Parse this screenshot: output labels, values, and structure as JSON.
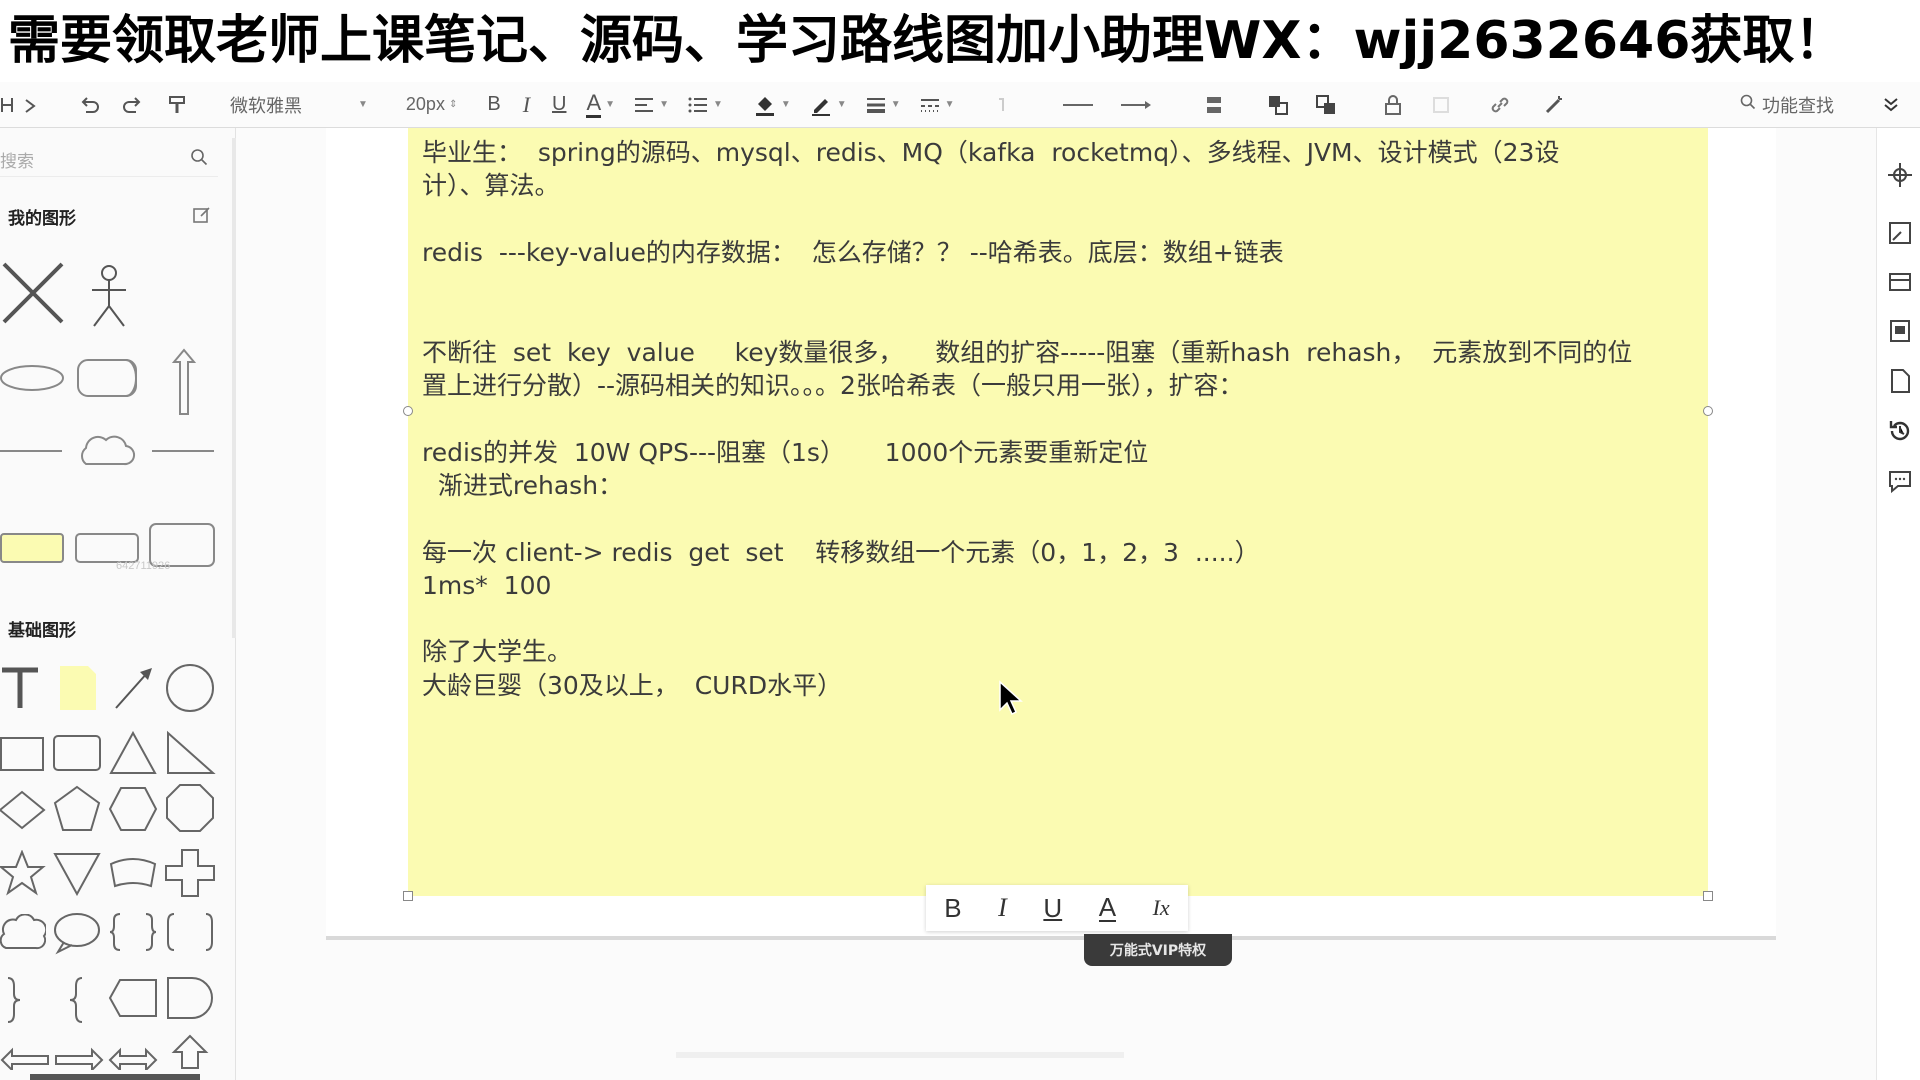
{
  "banner": {
    "text": "需要领取老师上课笔记、源码、学习路线图加小助理WX：wjj2632646获取！"
  },
  "toolbar": {
    "font_family": "微软雅黑",
    "font_size": "20px",
    "search_label": "功能查找"
  },
  "sidebar": {
    "search_placeholder": "搜索",
    "my_shapes_title": "我的图形",
    "basic_shapes_title": "基础图形",
    "faint_text": "642711926"
  },
  "note": {
    "lines": [
      "毕业生：  spring的源码、mysql、redis、MQ（kafka  rocketmq）、多线程、JVM、设计模式（23设",
      "计）、算法。",
      "",
      "redis  ---key-value的内存数据：  怎么存储？？ --哈希表。底层：数组+链表",
      "",
      "",
      "不断往  set  key  value     key数量很多，    数组的扩容-----阻塞（重新hash  rehash，  元素放到不同的位",
      "置上进行分散）--源码相关的知识。。。2张哈希表（一般只用一张），扩容：",
      "",
      "redis的并发  10W QPS---阻塞（1s）     1000个元素要重新定位",
      "  渐进式rehash：",
      "",
      "每一次 client-> redis  get  set    转移数组一个元素（0，1，2，3  .....）",
      "1ms*  100",
      "",
      "除了大学生。",
      "大龄巨婴（30及以上，  CURD水平）"
    ]
  },
  "format_bar": {
    "bold": "B",
    "italic": "I",
    "underline": "U",
    "font_color": "A",
    "clear": "Ix"
  },
  "vip_badge": "万能式VIP特权",
  "colors": {
    "note_fill": "#fbfbb2",
    "canvas_bg": "#fbfbfb"
  }
}
